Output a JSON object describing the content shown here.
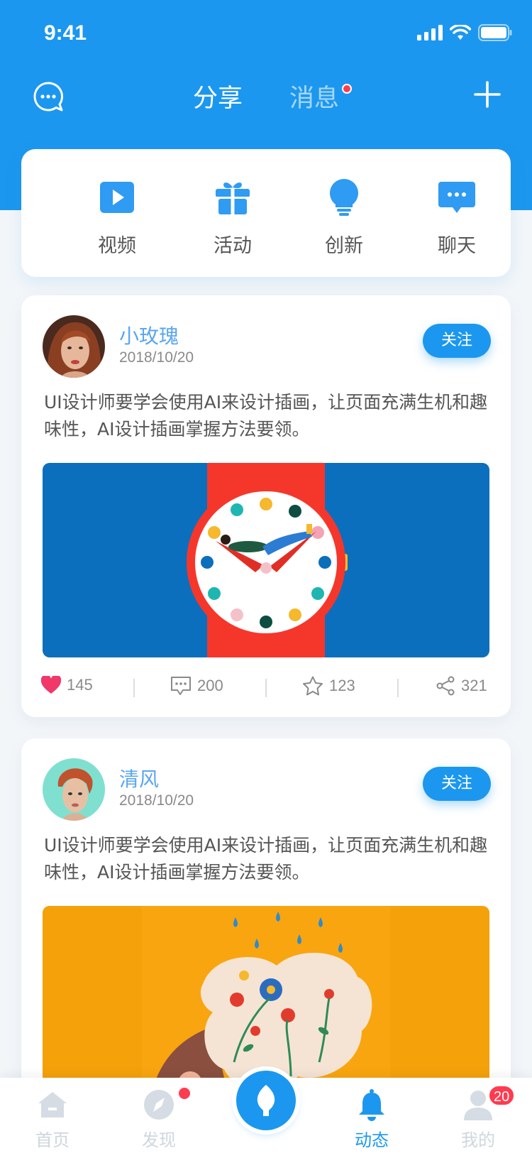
{
  "status_bar": {
    "time": "9:41"
  },
  "nav": {
    "tabs": [
      {
        "label": "分享",
        "active": true
      },
      {
        "label": "消息",
        "active": false,
        "has_dot": true
      }
    ]
  },
  "quick_menu": [
    {
      "label": "视频",
      "icon": "play-icon"
    },
    {
      "label": "活动",
      "icon": "gift-icon"
    },
    {
      "label": "创新",
      "icon": "lightbulb-icon"
    },
    {
      "label": "聊天",
      "icon": "chat-bubble-icon"
    }
  ],
  "posts": [
    {
      "author": "小玫瑰",
      "date": "2018/10/20",
      "follow_label": "关注",
      "content": "UI设计师要学会使用AI来设计插画，让页面充满生机和趣味性，AI设计插画掌握方法要领。",
      "stats": {
        "likes": "145",
        "comments": "200",
        "favorites": "123",
        "shares": "321"
      }
    },
    {
      "author": "清风",
      "date": "2018/10/20",
      "follow_label": "关注",
      "content": "UI设计师要学会使用AI来设计插画，让页面充满生机和趣味性，AI设计插画掌握方法要领。"
    }
  ],
  "tab_bar": {
    "items": [
      {
        "label": "首页",
        "icon": "home-icon"
      },
      {
        "label": "发现",
        "icon": "compass-icon",
        "has_dot": true
      },
      {
        "label": "",
        "icon": "leaf-icon"
      },
      {
        "label": "动态",
        "icon": "bell-icon",
        "active": true
      },
      {
        "label": "我的",
        "icon": "user-icon",
        "badge": "20"
      }
    ]
  },
  "colors": {
    "primary": "#1c97ef",
    "accent_red": "#ff3b4f",
    "name_blue": "#5aa6f0"
  }
}
